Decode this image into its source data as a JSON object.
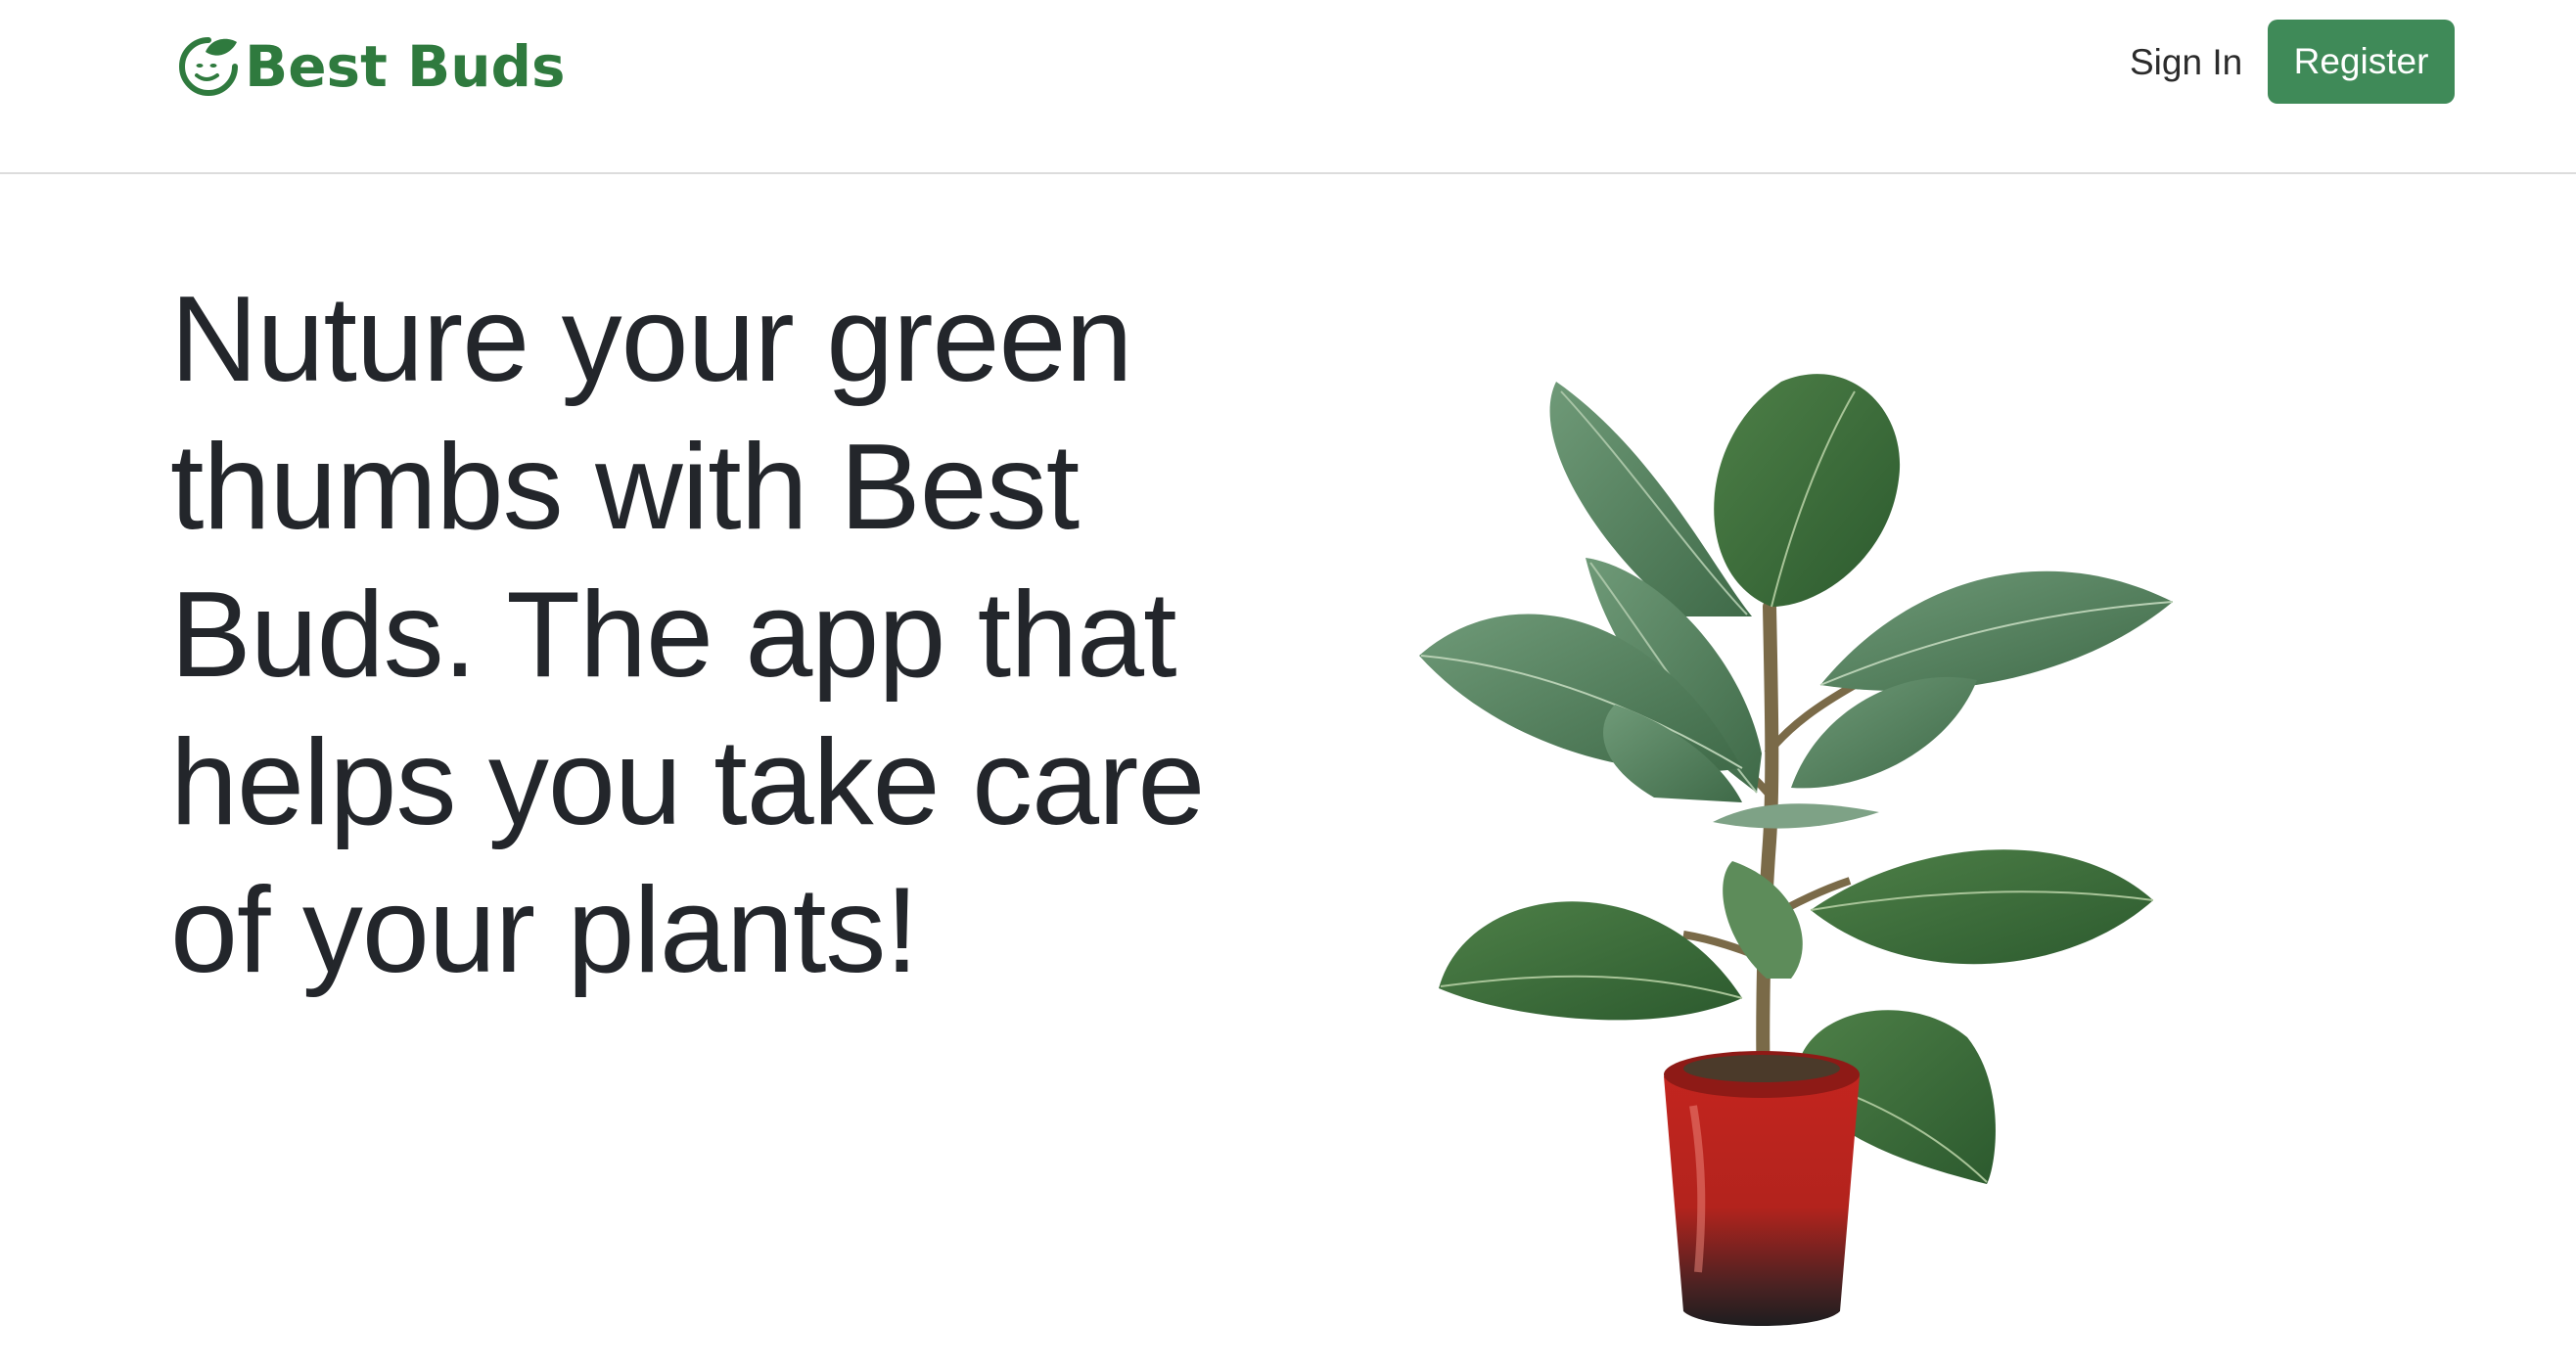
{
  "brand": {
    "name": "Best Buds",
    "color": "#2f7a3e"
  },
  "nav": {
    "signin_label": "Sign In",
    "register_label": "Register",
    "register_color": "#3f8a58"
  },
  "hero": {
    "title": "Nuture your green thumbs with Best Buds. The app that helps you take care of your plants!"
  },
  "image": {
    "subject": "potted rubber plant in red pot",
    "icon": "plant-illustration"
  }
}
